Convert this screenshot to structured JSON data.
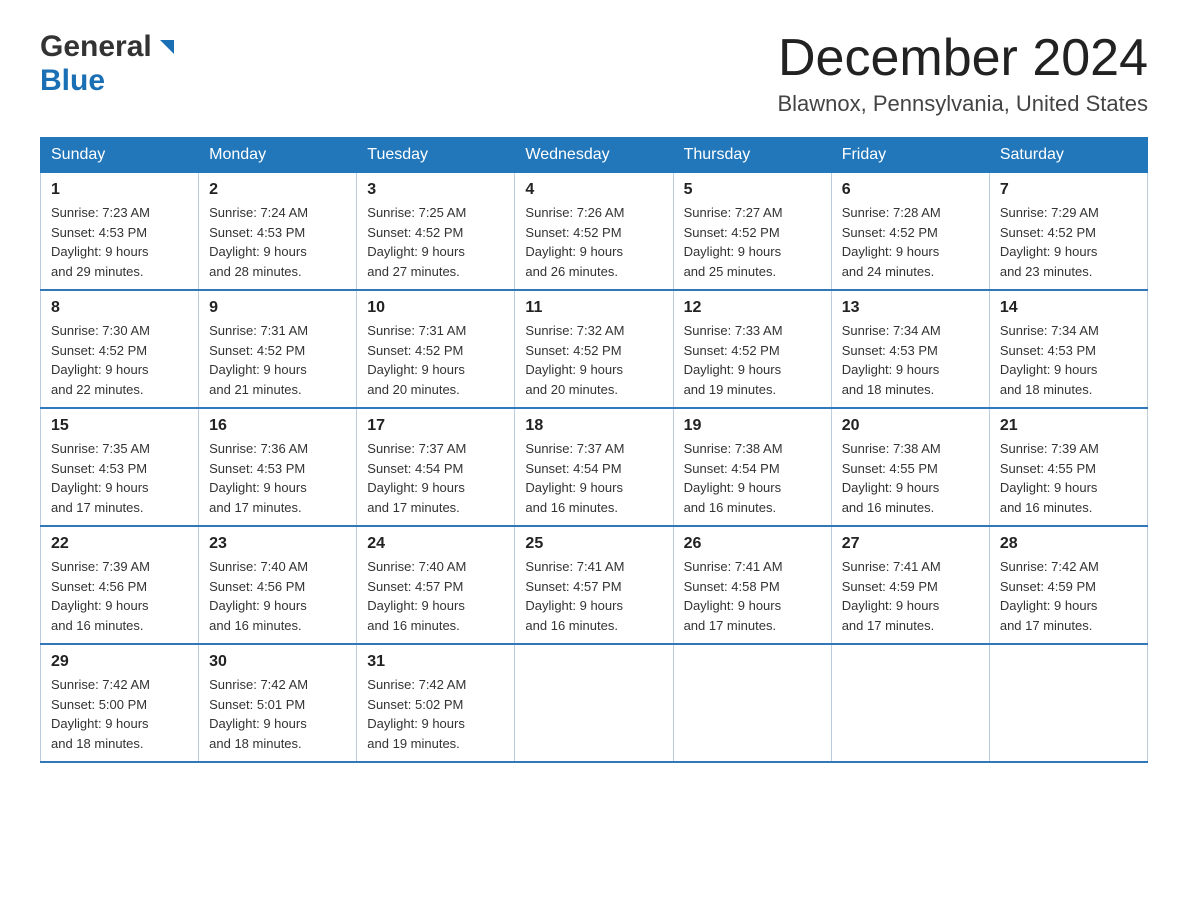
{
  "header": {
    "logo_general": "General",
    "logo_blue": "Blue",
    "month_title": "December 2024",
    "location": "Blawnox, Pennsylvania, United States"
  },
  "days_of_week": [
    "Sunday",
    "Monday",
    "Tuesday",
    "Wednesday",
    "Thursday",
    "Friday",
    "Saturday"
  ],
  "weeks": [
    [
      {
        "day": "1",
        "sunrise": "7:23 AM",
        "sunset": "4:53 PM",
        "daylight": "9 hours and 29 minutes."
      },
      {
        "day": "2",
        "sunrise": "7:24 AM",
        "sunset": "4:53 PM",
        "daylight": "9 hours and 28 minutes."
      },
      {
        "day": "3",
        "sunrise": "7:25 AM",
        "sunset": "4:52 PM",
        "daylight": "9 hours and 27 minutes."
      },
      {
        "day": "4",
        "sunrise": "7:26 AM",
        "sunset": "4:52 PM",
        "daylight": "9 hours and 26 minutes."
      },
      {
        "day": "5",
        "sunrise": "7:27 AM",
        "sunset": "4:52 PM",
        "daylight": "9 hours and 25 minutes."
      },
      {
        "day": "6",
        "sunrise": "7:28 AM",
        "sunset": "4:52 PM",
        "daylight": "9 hours and 24 minutes."
      },
      {
        "day": "7",
        "sunrise": "7:29 AM",
        "sunset": "4:52 PM",
        "daylight": "9 hours and 23 minutes."
      }
    ],
    [
      {
        "day": "8",
        "sunrise": "7:30 AM",
        "sunset": "4:52 PM",
        "daylight": "9 hours and 22 minutes."
      },
      {
        "day": "9",
        "sunrise": "7:31 AM",
        "sunset": "4:52 PM",
        "daylight": "9 hours and 21 minutes."
      },
      {
        "day": "10",
        "sunrise": "7:31 AM",
        "sunset": "4:52 PM",
        "daylight": "9 hours and 20 minutes."
      },
      {
        "day": "11",
        "sunrise": "7:32 AM",
        "sunset": "4:52 PM",
        "daylight": "9 hours and 20 minutes."
      },
      {
        "day": "12",
        "sunrise": "7:33 AM",
        "sunset": "4:52 PM",
        "daylight": "9 hours and 19 minutes."
      },
      {
        "day": "13",
        "sunrise": "7:34 AM",
        "sunset": "4:53 PM",
        "daylight": "9 hours and 18 minutes."
      },
      {
        "day": "14",
        "sunrise": "7:34 AM",
        "sunset": "4:53 PM",
        "daylight": "9 hours and 18 minutes."
      }
    ],
    [
      {
        "day": "15",
        "sunrise": "7:35 AM",
        "sunset": "4:53 PM",
        "daylight": "9 hours and 17 minutes."
      },
      {
        "day": "16",
        "sunrise": "7:36 AM",
        "sunset": "4:53 PM",
        "daylight": "9 hours and 17 minutes."
      },
      {
        "day": "17",
        "sunrise": "7:37 AM",
        "sunset": "4:54 PM",
        "daylight": "9 hours and 17 minutes."
      },
      {
        "day": "18",
        "sunrise": "7:37 AM",
        "sunset": "4:54 PM",
        "daylight": "9 hours and 16 minutes."
      },
      {
        "day": "19",
        "sunrise": "7:38 AM",
        "sunset": "4:54 PM",
        "daylight": "9 hours and 16 minutes."
      },
      {
        "day": "20",
        "sunrise": "7:38 AM",
        "sunset": "4:55 PM",
        "daylight": "9 hours and 16 minutes."
      },
      {
        "day": "21",
        "sunrise": "7:39 AM",
        "sunset": "4:55 PM",
        "daylight": "9 hours and 16 minutes."
      }
    ],
    [
      {
        "day": "22",
        "sunrise": "7:39 AM",
        "sunset": "4:56 PM",
        "daylight": "9 hours and 16 minutes."
      },
      {
        "day": "23",
        "sunrise": "7:40 AM",
        "sunset": "4:56 PM",
        "daylight": "9 hours and 16 minutes."
      },
      {
        "day": "24",
        "sunrise": "7:40 AM",
        "sunset": "4:57 PM",
        "daylight": "9 hours and 16 minutes."
      },
      {
        "day": "25",
        "sunrise": "7:41 AM",
        "sunset": "4:57 PM",
        "daylight": "9 hours and 16 minutes."
      },
      {
        "day": "26",
        "sunrise": "7:41 AM",
        "sunset": "4:58 PM",
        "daylight": "9 hours and 17 minutes."
      },
      {
        "day": "27",
        "sunrise": "7:41 AM",
        "sunset": "4:59 PM",
        "daylight": "9 hours and 17 minutes."
      },
      {
        "day": "28",
        "sunrise": "7:42 AM",
        "sunset": "4:59 PM",
        "daylight": "9 hours and 17 minutes."
      }
    ],
    [
      {
        "day": "29",
        "sunrise": "7:42 AM",
        "sunset": "5:00 PM",
        "daylight": "9 hours and 18 minutes."
      },
      {
        "day": "30",
        "sunrise": "7:42 AM",
        "sunset": "5:01 PM",
        "daylight": "9 hours and 18 minutes."
      },
      {
        "day": "31",
        "sunrise": "7:42 AM",
        "sunset": "5:02 PM",
        "daylight": "9 hours and 19 minutes."
      },
      null,
      null,
      null,
      null
    ]
  ],
  "labels": {
    "sunrise": "Sunrise:",
    "sunset": "Sunset:",
    "daylight": "Daylight:"
  }
}
